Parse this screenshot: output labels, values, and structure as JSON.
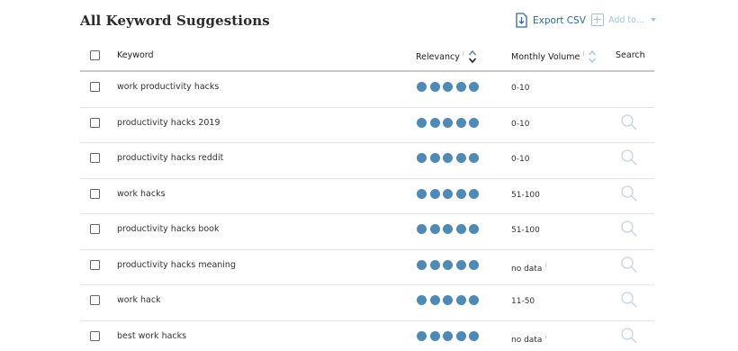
{
  "page": {
    "title": "All Keyword Suggestions"
  },
  "toolbar": {
    "export_label": "Export CSV",
    "add_to_label": "Add to..."
  },
  "table": {
    "columns": {
      "keyword": "Keyword",
      "relevancy": "Relevancy",
      "monthly_volume": "Monthly Volume",
      "search": "Search",
      "info_mark": "i"
    },
    "colors": {
      "dot": "#4f8ab5",
      "accent": "#2d6c9a",
      "muted_accent": "#9ec3dd"
    },
    "rows": [
      {
        "keyword": "work productivity hacks",
        "relevancy": 5,
        "volume": "0-10",
        "volume_info": "",
        "has_search_icon": false
      },
      {
        "keyword": "productivity hacks 2019",
        "relevancy": 5,
        "volume": "0-10",
        "volume_info": "",
        "has_search_icon": true
      },
      {
        "keyword": "productivity hacks reddit",
        "relevancy": 5,
        "volume": "0-10",
        "volume_info": "",
        "has_search_icon": true
      },
      {
        "keyword": "work hacks",
        "relevancy": 5,
        "volume": "51-100",
        "volume_info": "",
        "has_search_icon": true
      },
      {
        "keyword": "productivity hacks book",
        "relevancy": 5,
        "volume": "51-100",
        "volume_info": "",
        "has_search_icon": true
      },
      {
        "keyword": "productivity hacks meaning",
        "relevancy": 5,
        "volume": "no data",
        "volume_info": "i",
        "has_search_icon": true
      },
      {
        "keyword": "work hack",
        "relevancy": 5,
        "volume": "11-50",
        "volume_info": "",
        "has_search_icon": true
      },
      {
        "keyword": "best work hacks",
        "relevancy": 5,
        "volume": "no data",
        "volume_info": "i",
        "has_search_icon": true
      }
    ]
  }
}
